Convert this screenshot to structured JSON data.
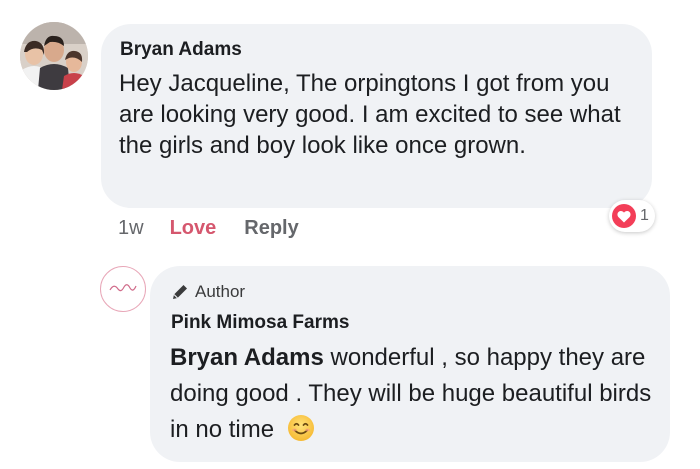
{
  "comment": {
    "author": "Bryan Adams",
    "text": "Hey Jacqueline, The orpingtons I got from you are looking very good. I am excited to see what the girls and boy look like once grown.",
    "time": "1w",
    "love_label": "Love",
    "reply_label": "Reply",
    "reaction_count": "1",
    "reaction_icon": "heart-icon",
    "reaction_color": "#f33e58"
  },
  "reply": {
    "badge": "Author",
    "author": "Pink Mimosa Farms",
    "mention": "Bryan Adams",
    "text": "wonderful , so happy they are doing good . They will be huge beautiful birds in no time",
    "emoji": "smiling-face-emoji"
  },
  "colors": {
    "bubble": "#f0f2f5",
    "love": "#d5576e",
    "meta": "#65676b"
  }
}
